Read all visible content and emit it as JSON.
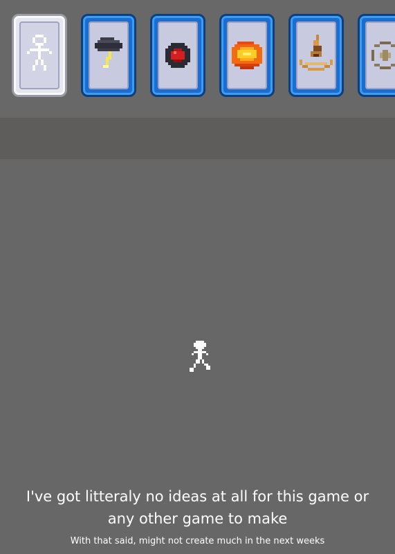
{
  "cards": [
    {
      "icon": "stickman-icon",
      "selected": true
    },
    {
      "icon": "storm-cloud-icon",
      "selected": false
    },
    {
      "icon": "red-orb-icon",
      "selected": false
    },
    {
      "icon": "fireball-icon",
      "selected": false
    },
    {
      "icon": "flame-pit-icon",
      "selected": false
    },
    {
      "icon": "ring-icon",
      "selected": false
    }
  ],
  "caption": {
    "line1": "I've got litteraly no ideas at all for this game or",
    "line2": "any other game to make",
    "small": "With that said, might not create much in the next weeks"
  },
  "colors": {
    "background": "#686768",
    "card_border": "#1b6ed0",
    "card_selected": "#e6e6ee"
  }
}
